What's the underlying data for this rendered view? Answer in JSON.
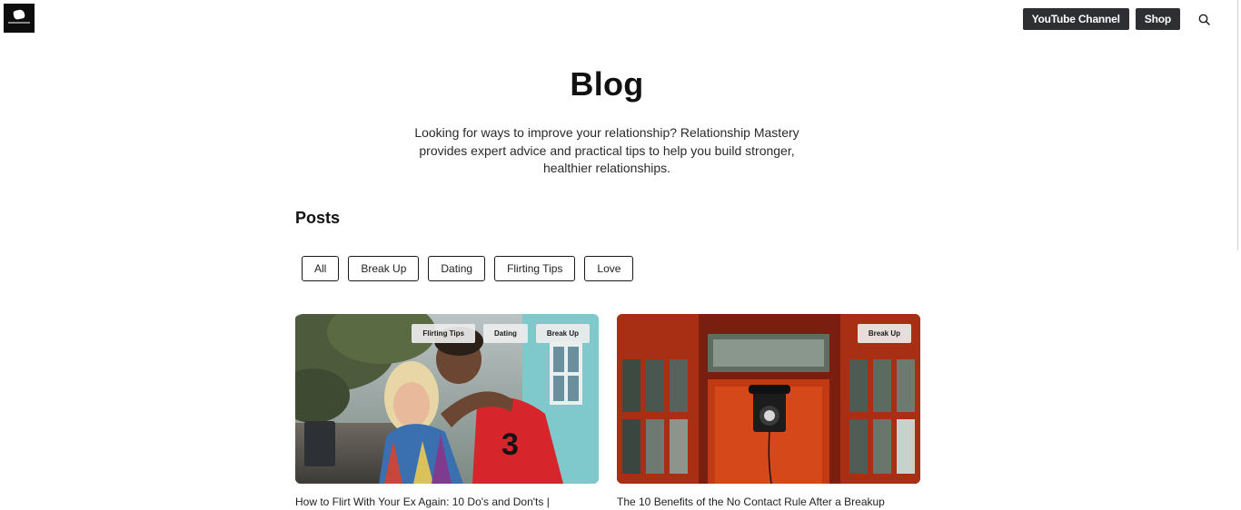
{
  "header": {
    "logo_icon": "brand-logo-icon",
    "youtube_label": "YouTube Channel",
    "shop_label": "Shop",
    "search_icon": "search-icon"
  },
  "hero": {
    "title": "Blog",
    "description": "Looking for ways to improve your relationship? Relationship Mastery provides expert advice and practical tips to help you build stronger, healthier relationships."
  },
  "posts": {
    "heading": "Posts",
    "filters": [
      "All",
      "Break Up",
      "Dating",
      "Flirting Tips",
      "Love"
    ],
    "cards": [
      {
        "tags": [
          "Flirting Tips",
          "Dating",
          "Break Up"
        ],
        "title": "How to Flirt With Your Ex Again: 10 Do's and Don'ts |"
      },
      {
        "tags": [
          "Break Up"
        ],
        "title": "The 10 Benefits of the No Contact Rule After a Breakup"
      }
    ]
  },
  "colors": {
    "button_dark": "#2e2f33",
    "text": "#111111",
    "tag_bg": "#ececec",
    "phonebox_red": "#c23a14"
  }
}
